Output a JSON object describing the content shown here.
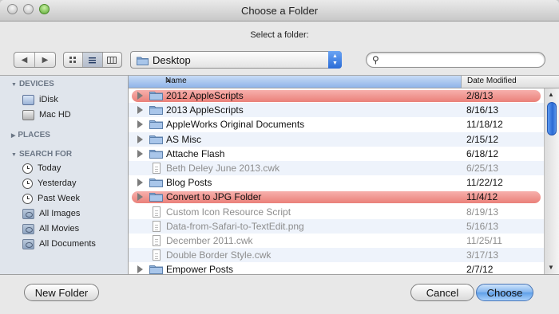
{
  "window": {
    "title": "Choose a Folder"
  },
  "prompt": "Select a folder:",
  "toolbar": {
    "back_icon": "back-arrow-icon",
    "forward_icon": "forward-arrow-icon",
    "view_modes": [
      "icon-view",
      "list-view",
      "column-view"
    ],
    "selected_view": "list-view",
    "path_popup": "Desktop",
    "search": {
      "value": "",
      "placeholder": ""
    }
  },
  "sidebar": {
    "devices_header": "DEVICES",
    "devices": [
      "iDisk",
      "Mac HD"
    ],
    "places_header": "PLACES",
    "search_header": "SEARCH FOR",
    "searches": [
      "Today",
      "Yesterday",
      "Past Week",
      "All Images",
      "All Movies",
      "All Documents"
    ]
  },
  "columns": {
    "name": "Name",
    "date": "Date Modified"
  },
  "files": [
    {
      "name": "2012 AppleScripts",
      "date": "2/8/13",
      "kind": "folder",
      "label": "red"
    },
    {
      "name": "2013 AppleScripts",
      "date": "8/16/13",
      "kind": "folder",
      "label": ""
    },
    {
      "name": "AppleWorks Original Documents",
      "date": "11/18/12",
      "kind": "folder",
      "label": ""
    },
    {
      "name": "AS Misc",
      "date": "2/15/12",
      "kind": "folder",
      "label": ""
    },
    {
      "name": "Attache Flash",
      "date": "6/18/12",
      "kind": "folder",
      "label": ""
    },
    {
      "name": "Beth Deley June 2013.cwk",
      "date": "6/25/13",
      "kind": "file",
      "label": ""
    },
    {
      "name": "Blog Posts",
      "date": "11/22/12",
      "kind": "folder",
      "label": ""
    },
    {
      "name": "Convert to JPG Folder",
      "date": "11/4/12",
      "kind": "folder",
      "label": "red"
    },
    {
      "name": "Custom Icon Resource Script",
      "date": "8/19/13",
      "kind": "file",
      "label": ""
    },
    {
      "name": "Data-from-Safari-to-TextEdit.png",
      "date": "5/16/13",
      "kind": "file",
      "label": ""
    },
    {
      "name": "December  2011.cwk",
      "date": "11/25/11",
      "kind": "file",
      "label": ""
    },
    {
      "name": "Double Border Style.cwk",
      "date": "3/17/13",
      "kind": "file",
      "label": ""
    },
    {
      "name": "Empower Posts",
      "date": "2/7/12",
      "kind": "folder",
      "label": ""
    }
  ],
  "buttons": {
    "new_folder": "New Folder",
    "cancel": "Cancel",
    "choose": "Choose"
  },
  "colors": {
    "label_red": "#ea8079",
    "selection_blue": "#2a69d4",
    "disabled_text": "#8d8d8d"
  }
}
